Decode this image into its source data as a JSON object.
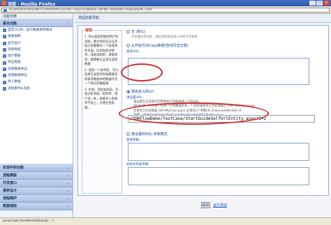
{
  "window": {
    "title": "流程 - Mozilla Firefox",
    "buttons": [
      "_",
      "□",
      "×"
    ]
  },
  "address_bar": {
    "url": "localhost/ccflow/WF/Comm/RefFunc/UIEn.aspx?EnName=BP.WF.Template.FlowExt&PK=034"
  },
  "sidebar": {
    "header": "功能列表",
    "groups": [
      {
        "label": "基本功能",
        "expanded": true,
        "items": [
          "自定义URL: 设计数据保存模式",
          "发起限制",
          "显示设计",
          "流程导航",
          "设计模板",
          "导出发起",
          "流程模板导出",
          "流程数据导出",
          "导入数据",
          "流程事件&消息"
        ]
      },
      {
        "label": "实现中的功能"
      },
      {
        "label": "流程模版"
      },
      {
        "label": "开发接口"
      },
      {
        "label": "报表设计"
      },
      {
        "label": "流程维护"
      },
      {
        "label": "数据抽取"
      }
    ]
  },
  "main": {
    "header": "发起前置导航",
    "help": {
      "title": "帮助",
      "items": [
        "1. 所以发起单据到用户的流程，要达到首先在在开始之前都要有一个表选择的页面，比如发起付款单，或者采购单，请假单等，都需要在这里先选择数据",
        "2. 选择一个表单后，可以选择在发起的时候都要选择表单数据中的数据作为一个默认的数据源",
        "3. 比如：流程发起前，先到分析单前一到单单，用户选一条，就被导入到表单字段上，方便业务处理。"
      ]
    },
    "options": [
      {
        "label": "无 (默认)",
        "desc": "不设置任何导航，发起流程直接进入开始节点表单。",
        "selected": false
      },
      {
        "label": "从开始节点Copy数据(查询历史记录)",
        "desc": "",
        "selected": false,
        "field_label": "查询SQL:"
      },
      {
        "label": "按自定义的Url",
        "desc": "",
        "selected": true,
        "field_label": "请设置URL:",
        "examples": [
          "请设置在这里填写的需要执行的数据源入口的URL",
          "该URL是一个列表，在每一行的数据后有一个连接链接到工作处理器上 (/WF/MyFlow.aspx)",
          "连接到工作处理器 (WF/MyFlow.aspx) 必须有2个参数FK_Flowxxx&WorkID=0",
          "示例：/SDKFlowDemo/TestCase/StartGuideSelfUrlEntity.aspx",
          "注意：在连接的打开工作处理器的时候，我们需要在获取参数，就可以把参数传递到开始节点里面"
        ],
        "url_value": "/SDKFlowDemo/TestCase/StartGuideSelfUrlEntity.aspx?1=2"
      },
      {
        "label": "按设置的SQL-单条模式",
        "desc": "",
        "selected": false,
        "field_label": "查询参数:",
        "field_label2": "初始化列表参数:"
      }
    ],
    "actions": {
      "save": "保存",
      "run": "运行测试"
    }
  },
  "status_bar": {
    "text": "javascript:showModalDialog('...')"
  }
}
